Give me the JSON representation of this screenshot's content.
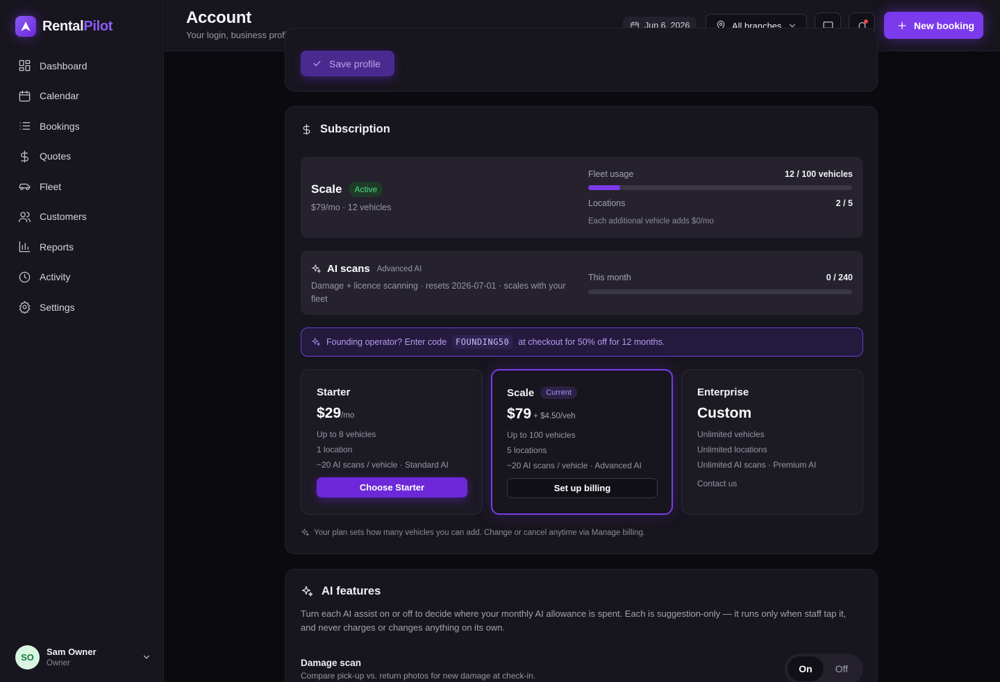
{
  "brand": {
    "name_a": "Rental",
    "name_b": "Pilot",
    "accent": "#7c3aed"
  },
  "sidebar": {
    "items": [
      {
        "label": "Dashboard",
        "icon": "dashboard-icon"
      },
      {
        "label": "Calendar",
        "icon": "calendar-icon"
      },
      {
        "label": "Bookings",
        "icon": "list-icon"
      },
      {
        "label": "Quotes",
        "icon": "dollar-icon"
      },
      {
        "label": "Fleet",
        "icon": "car-icon"
      },
      {
        "label": "Customers",
        "icon": "users-icon"
      },
      {
        "label": "Reports",
        "icon": "chart-icon"
      },
      {
        "label": "Activity",
        "icon": "clock-icon"
      },
      {
        "label": "Settings",
        "icon": "gear-icon"
      }
    ],
    "user": {
      "initials": "SO",
      "name": "Sam Owner",
      "role": "Owner"
    }
  },
  "header": {
    "title": "Account",
    "subtitle": "Your login, business profile, and plan",
    "date": "Jun 6, 2026",
    "branch": "All branches",
    "new_booking": "New booking"
  },
  "profile": {
    "save_label": "Save profile"
  },
  "subscription": {
    "title": "Subscription",
    "plan": {
      "name": "Scale",
      "status": "Active",
      "meta": "$79/mo · 12 vehicles"
    },
    "fleet_usage": {
      "label": "Fleet usage",
      "value": "12 / 100 vehicles",
      "fraction": 0.12
    },
    "locations": {
      "label": "Locations",
      "value": "2 / 5"
    },
    "usage_note": "Each additional vehicle adds $0/mo",
    "ai_scans": {
      "title": "AI scans",
      "tag": "Advanced AI",
      "desc": "Damage + licence scanning · resets 2026-07-01 · scales with your fleet",
      "month_label": "This month",
      "month_value": "0 / 240",
      "fraction": 0
    },
    "promo": {
      "before": "Founding operator? Enter code",
      "code": "FOUNDING50",
      "after": "at checkout for 50% off for 12 months."
    },
    "tiers": [
      {
        "name": "Starter",
        "badge": "",
        "price": "$29",
        "unit": "/mo",
        "lines": [
          "Up to 8 vehicles",
          "1 location",
          "~20 AI scans / vehicle · Standard AI"
        ],
        "cta": "Choose Starter"
      },
      {
        "name": "Scale",
        "badge": "Current",
        "price": "$79",
        "unit": " + $4.50/veh",
        "lines": [
          "Up to 100 vehicles",
          "5 locations",
          "~20 AI scans / vehicle · Advanced AI"
        ],
        "cta": "Set up billing"
      },
      {
        "name": "Enterprise",
        "badge": "",
        "price": "Custom",
        "unit": "",
        "lines": [
          "Unlimited vehicles",
          "Unlimited locations",
          "Unlimited AI scans · Premium AI",
          "Contact us"
        ],
        "cta": ""
      }
    ],
    "foot_note": "Your plan sets how many vehicles you can add. Change or cancel anytime via Manage billing."
  },
  "ai_features": {
    "title": "AI features",
    "desc": "Turn each AI assist on or off to decide where your monthly AI allowance is spent. Each is suggestion-only — it runs only when staff tap it, and never charges or changes anything on its own.",
    "feature": {
      "name": "Damage scan",
      "desc": "Compare pick-up vs. return photos for new damage at check-in.",
      "on": "On",
      "off": "Off"
    }
  }
}
